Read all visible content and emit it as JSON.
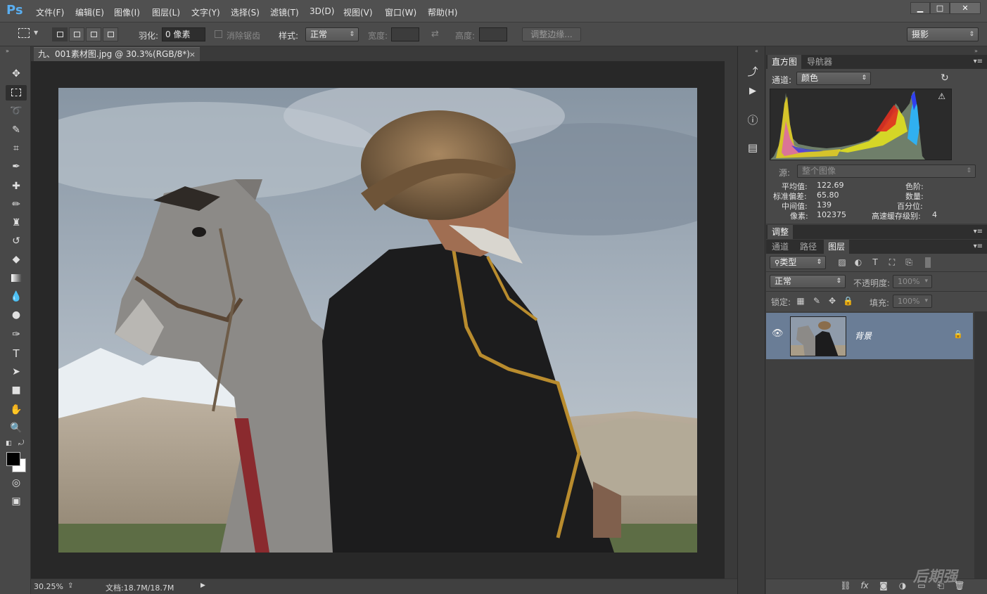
{
  "app": {
    "logo": "Ps"
  },
  "menu": [
    "文件(F)",
    "编辑(E)",
    "图像(I)",
    "图层(L)",
    "文字(Y)",
    "选择(S)",
    "滤镜(T)",
    "3D(D)",
    "视图(V)",
    "窗口(W)",
    "帮助(H)"
  ],
  "window_controls": {
    "minimize": "▁",
    "maximize": "□",
    "close": "✕"
  },
  "options": {
    "feather_label": "羽化:",
    "feather_value": "0 像素",
    "antialias_label": "消除锯齿",
    "style_label": "样式:",
    "style_value": "正常",
    "width_label": "宽度:",
    "height_label": "高度:",
    "refine_edge": "调整边缘...",
    "workspace": "摄影"
  },
  "document": {
    "tab_title": "九、001素材图.jpg @ 30.3%(RGB/8*)",
    "tab_close": "×",
    "zoom": "30.25%",
    "doc_size": "文档:18.7M/18.7M"
  },
  "histogram_panel": {
    "tabs": [
      "直方图",
      "导航器"
    ],
    "channel_label": "通道:",
    "channel_value": "颜色",
    "source_label": "源:",
    "source_value": "整个图像",
    "stats": {
      "mean_label": "平均值:",
      "mean": "122.69",
      "std_label": "标准偏差:",
      "std": "65.80",
      "median_label": "中间值:",
      "median": "139",
      "pixels_label": "像素:",
      "pixels": "102375",
      "level_label": "色阶:",
      "count_label": "数量:",
      "percentile_label": "百分位:",
      "cache_label": "高速缓存级别:",
      "cache": "4"
    }
  },
  "adjust_panel": {
    "title": "调整"
  },
  "layers_panel": {
    "tabs": [
      "通道",
      "路径",
      "图层"
    ],
    "filter_value": "类型",
    "blend_value": "正常",
    "opacity_label": "不透明度:",
    "opacity_value": "100%",
    "lock_label": "锁定:",
    "fill_label": "填充:",
    "fill_value": "100%",
    "layer_name": "背景"
  },
  "watermark": "后期强",
  "colors": {
    "accent": "#5aaef0",
    "panel": "#484848",
    "selected_layer": "#6a7d96"
  }
}
